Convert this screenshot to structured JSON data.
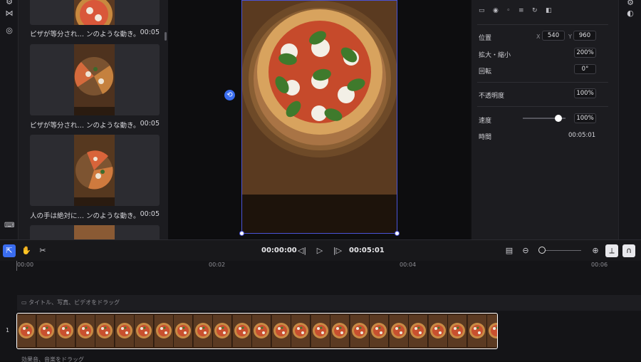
{
  "media_items": [
    {
      "caption": "ピザが等分され… ンのような動き。",
      "duration": "00:05"
    },
    {
      "caption": "ピザが等分され… ンのような動き。",
      "duration": "00:05"
    },
    {
      "caption": "人の手は絶対に… ンのような動き。",
      "duration": "00:05"
    }
  ],
  "properties": {
    "position_label": "位置",
    "x_label": "X",
    "x_value": "540",
    "y_label": "Y",
    "y_value": "960",
    "scale_label": "拡大・縮小",
    "scale_value": "200%",
    "rotation_label": "回転",
    "rotation_value": "0°",
    "opacity_label": "不透明度",
    "opacity_value": "100%",
    "speed_label": "速度",
    "speed_value": "100%",
    "speed_level": 0.5,
    "duration_label": "時間",
    "duration_value": "00:05:01"
  },
  "toolbar": {
    "current_time": "00:00:00",
    "total_time": "00:05:01"
  },
  "ruler": [
    "00:00",
    "00:02",
    "00:04",
    "00:06"
  ],
  "timeline": {
    "drop_hint_text": "タイトル、写真、ビデオをドラッグ",
    "track_number": "1",
    "drop_hint_audio": "効果音、音楽をドラッグ"
  },
  "icons": [
    "select-icon",
    "hand-icon",
    "scissors-icon",
    "play-icon",
    "prev-frame-icon",
    "next-frame-icon",
    "zoom-in-icon",
    "zoom-out-icon",
    "rotate-icon",
    "keyboard-icon"
  ]
}
